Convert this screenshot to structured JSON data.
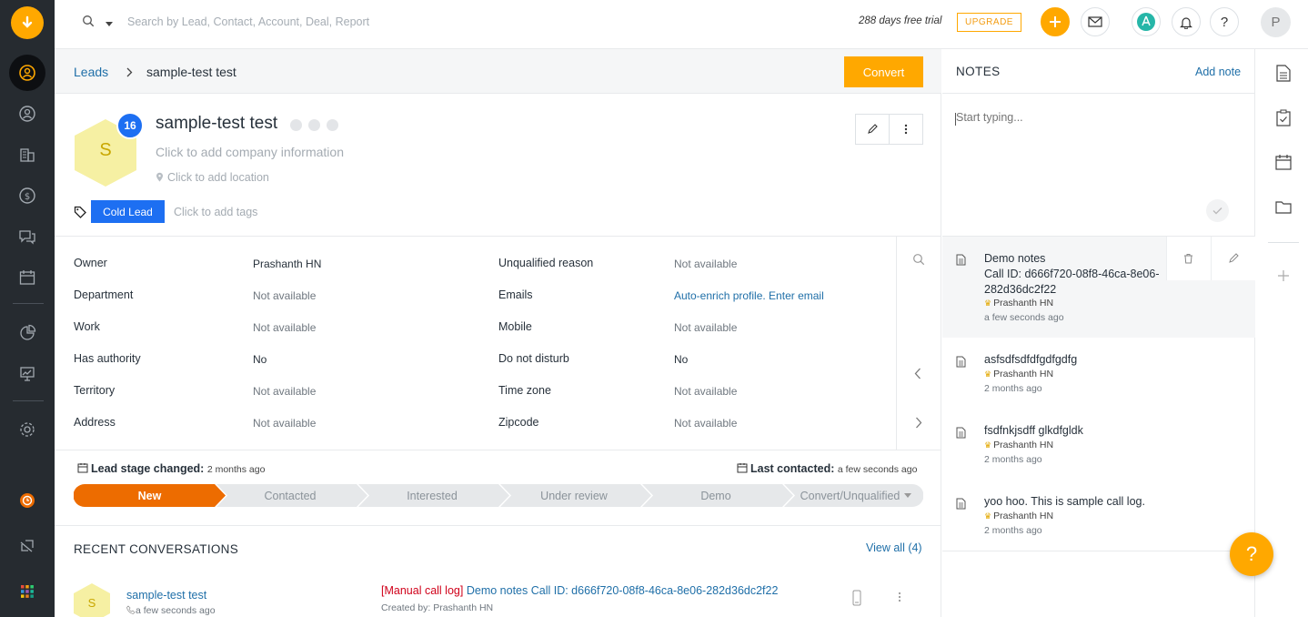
{
  "search": {
    "placeholder": "Search by Lead, Contact, Account, Deal, Report"
  },
  "topbar": {
    "trial_text": "288 days free trial",
    "upgrade_label": "UPGRADE",
    "user_initial": "P"
  },
  "breadcrumb": {
    "root": "Leads",
    "current": "sample-test test"
  },
  "actions": {
    "convert_label": "Convert"
  },
  "lead": {
    "initial": "S",
    "badge_count": "16",
    "name": "sample-test test",
    "company_placeholder": "Click to add company information",
    "location_placeholder": "Click to add location",
    "tag": "Cold Lead",
    "tags_placeholder": "Click to add tags"
  },
  "fields_left": [
    {
      "label": "Owner",
      "value": "Prashanth HN"
    },
    {
      "label": "Department",
      "value": "Not available"
    },
    {
      "label": "Work",
      "value": "Not available"
    },
    {
      "label": "Has authority",
      "value": "No"
    },
    {
      "label": "Territory",
      "value": "Not available"
    },
    {
      "label": "Address",
      "value": "Not available"
    }
  ],
  "fields_right": [
    {
      "label": "Unqualified reason",
      "value": "Not available"
    },
    {
      "label": "Emails",
      "value": "Auto-enrich profile. Enter email"
    },
    {
      "label": "Mobile",
      "value": "Not available"
    },
    {
      "label": "Do not disturb",
      "value": "No"
    },
    {
      "label": "Time zone",
      "value": "Not available"
    },
    {
      "label": "Zipcode",
      "value": "Not available"
    }
  ],
  "stage_info": {
    "changed_label": "Lead stage changed:",
    "changed_value": "2 months ago",
    "contacted_label": "Last contacted:",
    "contacted_value": "a few seconds ago"
  },
  "stages": [
    "New",
    "Contacted",
    "Interested",
    "Under review",
    "Demo",
    "Convert/Unqualified"
  ],
  "colors": {
    "accent": "#ffa800",
    "stage_active": "#ed6c00",
    "link": "#1f6fa8",
    "badge": "#1d6ff2",
    "nav_bg": "#262b30"
  },
  "conversations": {
    "title": "RECENT CONVERSATIONS",
    "view_all": "View all (4)",
    "item": {
      "initial": "S",
      "name": "sample-test test",
      "time": "a few seconds ago",
      "type": "Manual call log",
      "message": "Demo notes Call ID: d666f720-08f8-46ca-8e06-282d36dc2f22",
      "created_by": "Created by: Prashanth HN"
    }
  },
  "notes": {
    "title": "NOTES",
    "add_label": "Add note",
    "input_placeholder": "Start typing...",
    "items": [
      {
        "line1": "Demo notes",
        "line2": "Call ID: d666f720-08f8-46ca-8e06-",
        "line3": "282d36dc2f22",
        "author": "Prashanth HN",
        "time": "a few seconds ago"
      },
      {
        "line1": "asfsdfsdfdfgdfgdfg",
        "author": "Prashanth HN",
        "time": "2 months ago"
      },
      {
        "line1": "fsdfnkjsdff glkdfgldk",
        "author": "Prashanth HN",
        "time": "2 months ago"
      },
      {
        "line1": "yoo hoo. This is sample call log.",
        "author": "Prashanth HN",
        "time": "2 months ago"
      }
    ]
  },
  "help": {
    "label": "?"
  }
}
